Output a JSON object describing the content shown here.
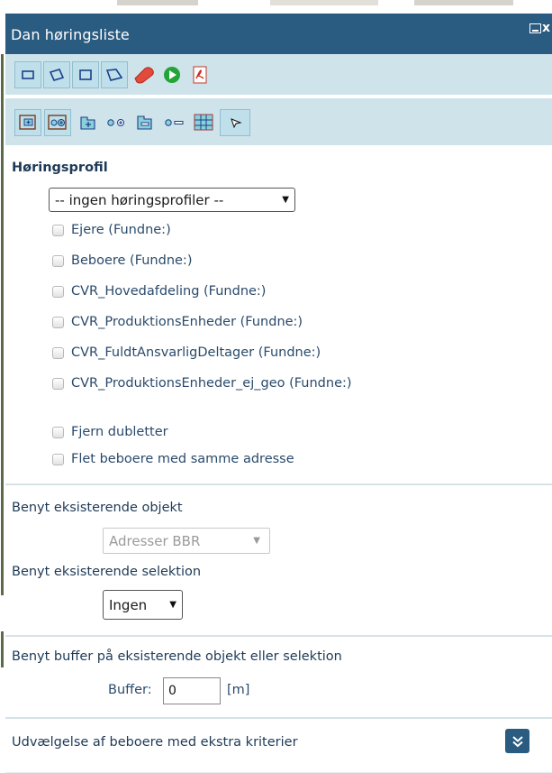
{
  "window": {
    "title": "Dan høringsliste",
    "minimize_icon": "minimize-icon",
    "close_icon": "close-icon",
    "close_glyph": "x"
  },
  "toolbar_row1": [
    {
      "name": "draw-rectangle-tool-icon",
      "icon": "rectangle"
    },
    {
      "name": "draw-polygon-tool-icon",
      "icon": "polygon"
    },
    {
      "name": "draw-square-tool-icon",
      "icon": "square"
    },
    {
      "name": "draw-freeform-polygon-tool-icon",
      "icon": "freeform-polygon"
    },
    {
      "name": "eraser-tool-icon",
      "icon": "eraser"
    },
    {
      "name": "run-icon",
      "icon": "play-green"
    },
    {
      "name": "pdf-export-icon",
      "icon": "pdf"
    }
  ],
  "toolbar_row2": [
    {
      "name": "add-rectangle-selection-icon",
      "icon": "add-rectangle"
    },
    {
      "name": "add-circle-selection-icon",
      "icon": "add-circle"
    },
    {
      "name": "add-feature-icon",
      "icon": "add-feature"
    },
    {
      "name": "add-point-icon",
      "icon": "add-point"
    },
    {
      "name": "remove-feature-icon",
      "icon": "remove-feature"
    },
    {
      "name": "remove-point-icon",
      "icon": "remove-point"
    },
    {
      "name": "grid-select-icon",
      "icon": "grid"
    },
    {
      "name": "pointer-select-icon",
      "icon": "pointer"
    }
  ],
  "hoeringsprofil": {
    "label": "Høringsprofil",
    "select_value": "-- ingen høringsprofiler --",
    "select_arrow": "▼",
    "checkboxes": [
      {
        "label": "Ejere (Fundne:)",
        "checked": false
      },
      {
        "label": "Beboere (Fundne:)",
        "checked": false
      },
      {
        "label": "CVR_Hovedafdeling (Fundne:)",
        "checked": false
      },
      {
        "label": "CVR_ProduktionsEnheder (Fundne:)",
        "checked": false
      },
      {
        "label": "CVR_FuldtAnsvarligDeltager (Fundne:)",
        "checked": false
      },
      {
        "label": "CVR_ProduktionsEnheder_ej_geo (Fundne:)",
        "checked": false
      }
    ],
    "options": [
      {
        "label": "Fjern dubletter",
        "checked": false
      },
      {
        "label": "Flet beboere med samme adresse",
        "checked": false
      }
    ]
  },
  "eksisterende_objekt": {
    "label": "Benyt eksisterende objekt",
    "select_value": "Adresser BBR",
    "select_arrow": "▼",
    "disabled": true
  },
  "eksisterende_selektion": {
    "label": "Benyt eksisterende selektion",
    "select_value": "Ingen",
    "select_arrow": "▼"
  },
  "buffer": {
    "label": "Benyt buffer på eksisterende objekt eller selektion",
    "field_label": "Buffer:",
    "value": "0",
    "unit": "[m]"
  },
  "ekstra_kriterier": {
    "label": "Udvælgelse af beboere med ekstra kriterier",
    "expand_icon": "chevron-double-down-icon"
  },
  "colors": {
    "titlebar": "#2a5b80",
    "toolbar": "#cfe3ea",
    "text": "#1e3a57",
    "accent": "#2a5b80"
  }
}
